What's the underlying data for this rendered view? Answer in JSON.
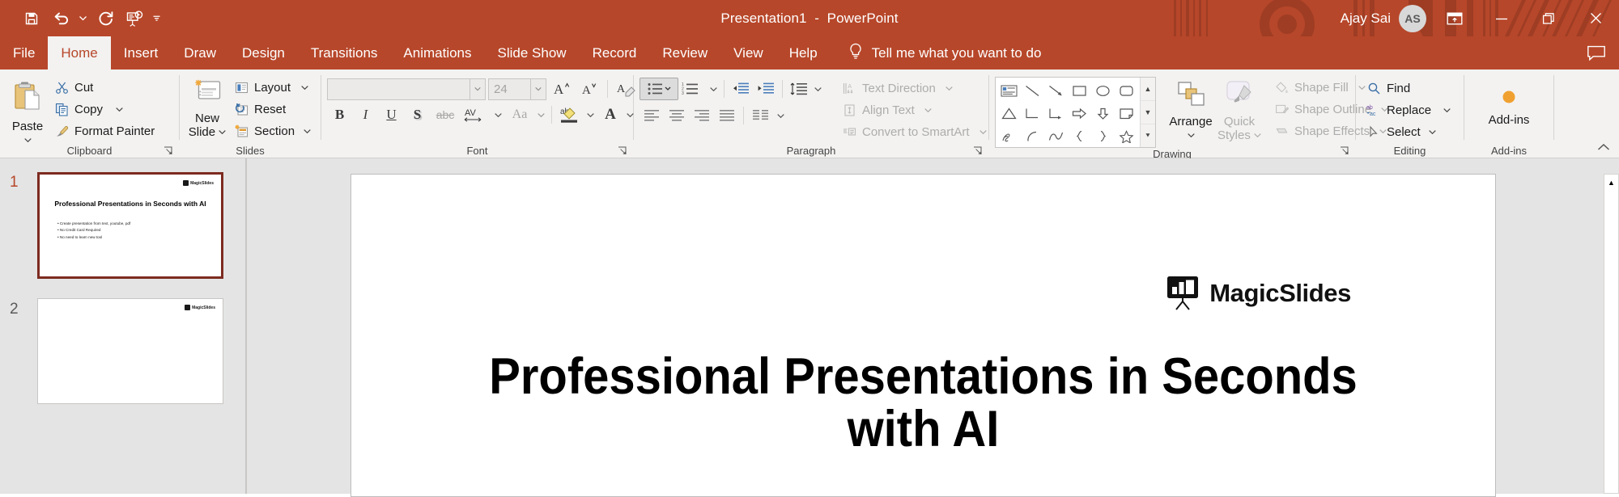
{
  "titlebar": {
    "document_name": "Presentation1",
    "separator": "  -  ",
    "app_name": "PowerPoint",
    "account_name": "Ajay Sai",
    "account_initials": "AS",
    "accent_color": "#b7472a",
    "qat": [
      {
        "name": "save",
        "label": "Save",
        "icon": "save-icon"
      },
      {
        "name": "undo",
        "label": "Undo",
        "icon": "undo-icon"
      },
      {
        "name": "undo-dropdown",
        "label": "Undo options",
        "icon": "chevron-down-icon"
      },
      {
        "name": "redo",
        "label": "Redo",
        "icon": "redo-icon"
      },
      {
        "name": "start-from-beginning",
        "label": "Start From Beginning",
        "icon": "slideshow-icon"
      },
      {
        "name": "customize-qat",
        "label": "Customize Quick Access Toolbar",
        "icon": "chevron-down-small-icon"
      }
    ],
    "window_controls": [
      {
        "name": "ribbon-display-options",
        "label": "Ribbon Display Options",
        "icon": "ribbon-display-icon"
      },
      {
        "name": "minimize",
        "label": "Minimize",
        "icon": "minimize-icon"
      },
      {
        "name": "restore",
        "label": "Restore Down",
        "icon": "restore-icon"
      },
      {
        "name": "close",
        "label": "Close",
        "icon": "close-icon"
      }
    ]
  },
  "tabs": {
    "items": [
      {
        "label": "File",
        "active": false
      },
      {
        "label": "Home",
        "active": true
      },
      {
        "label": "Insert",
        "active": false
      },
      {
        "label": "Draw",
        "active": false
      },
      {
        "label": "Design",
        "active": false
      },
      {
        "label": "Transitions",
        "active": false
      },
      {
        "label": "Animations",
        "active": false
      },
      {
        "label": "Slide Show",
        "active": false
      },
      {
        "label": "Record",
        "active": false
      },
      {
        "label": "Review",
        "active": false
      },
      {
        "label": "View",
        "active": false
      },
      {
        "label": "Help",
        "active": false
      }
    ],
    "tell_me": "Tell me what you want to do",
    "comment_label": "Comments"
  },
  "ribbon": {
    "clipboard": {
      "group_label": "Clipboard",
      "paste_label": "Paste",
      "cut_label": "Cut",
      "copy_label": "Copy",
      "format_painter_label": "Format Painter",
      "dialog_launcher_label": "Clipboard dialog launcher"
    },
    "slides": {
      "group_label": "Slides",
      "new_slide_line1": "New",
      "new_slide_line2": "Slide",
      "layout_label": "Layout",
      "reset_label": "Reset",
      "section_label": "Section"
    },
    "font": {
      "group_label": "Font",
      "font_name_value": "",
      "font_size_value": "24",
      "increase_size_label": "Increase Font Size",
      "decrease_size_label": "Decrease Font Size",
      "clear_formatting_label": "Clear All Formatting",
      "bold_label": "B",
      "italic_label": "I",
      "underline_label": "U",
      "shadow_label": "S",
      "strikethrough_label": "abc",
      "char_spacing_label": "AV",
      "change_case_label": "Aa",
      "highlight_label": "Text Highlight Color",
      "font_color_label": "A"
    },
    "paragraph": {
      "group_label": "Paragraph",
      "bullets_label": "Bullets",
      "numbering_label": "Numbering",
      "decrease_indent_label": "Decrease List Level",
      "increase_indent_label": "Increase List Level",
      "line_spacing_label": "Line Spacing",
      "align_left_label": "Align Left",
      "align_center_label": "Center",
      "align_right_label": "Align Right",
      "justify_label": "Justify",
      "columns_label": "Add or Remove Columns",
      "text_direction_label": "Text Direction",
      "align_text_label": "Align Text",
      "convert_smartart_label": "Convert to SmartArt"
    },
    "drawing": {
      "group_label": "Drawing",
      "arrange_label": "Arrange",
      "quick_styles_line1": "Quick",
      "quick_styles_line2": "Styles",
      "shape_fill_label": "Shape Fill",
      "shape_outline_label": "Shape Outline",
      "shape_effects_label": "Shape Effects",
      "shapes": [
        "text-box-shape",
        "line-shape",
        "arrow-shape",
        "rectangle-shape",
        "oval-shape",
        "rounded-rectangle-shape",
        "triangle-shape",
        "elbow-connector-shape",
        "elbow-arrow-connector-shape",
        "right-arrow-shape",
        "down-arrow-shape",
        "folded-corner-shape",
        "scribble-shape",
        "arc-shape",
        "curve-shape",
        "left-brace-shape",
        "right-brace-shape",
        "star-shape"
      ]
    },
    "editing": {
      "group_label": "Editing",
      "find_label": "Find",
      "replace_label": "Replace",
      "select_label": "Select"
    },
    "addins": {
      "group_label": "Add-ins",
      "addins_label": "Add-ins",
      "badge_color": "#f0a030"
    },
    "collapse_label": "Collapse the Ribbon"
  },
  "thumbnails": [
    {
      "number": "1",
      "selected": true,
      "logo_text": "MagicSlides",
      "title": "Professional Presentations in Seconds with AI",
      "bullets": [
        "Create presentation from text, youtube, pdf",
        "No Credit Card Required",
        "No need to learn new tool"
      ]
    },
    {
      "number": "2",
      "selected": false,
      "logo_text": "MagicSlides",
      "title": "",
      "bullets": []
    }
  ],
  "slide": {
    "logo_text": "MagicSlides",
    "title_line1": "Professional Presentations in Seconds",
    "title_line2": "with AI",
    "scroll_up_label": "Scroll Up"
  }
}
